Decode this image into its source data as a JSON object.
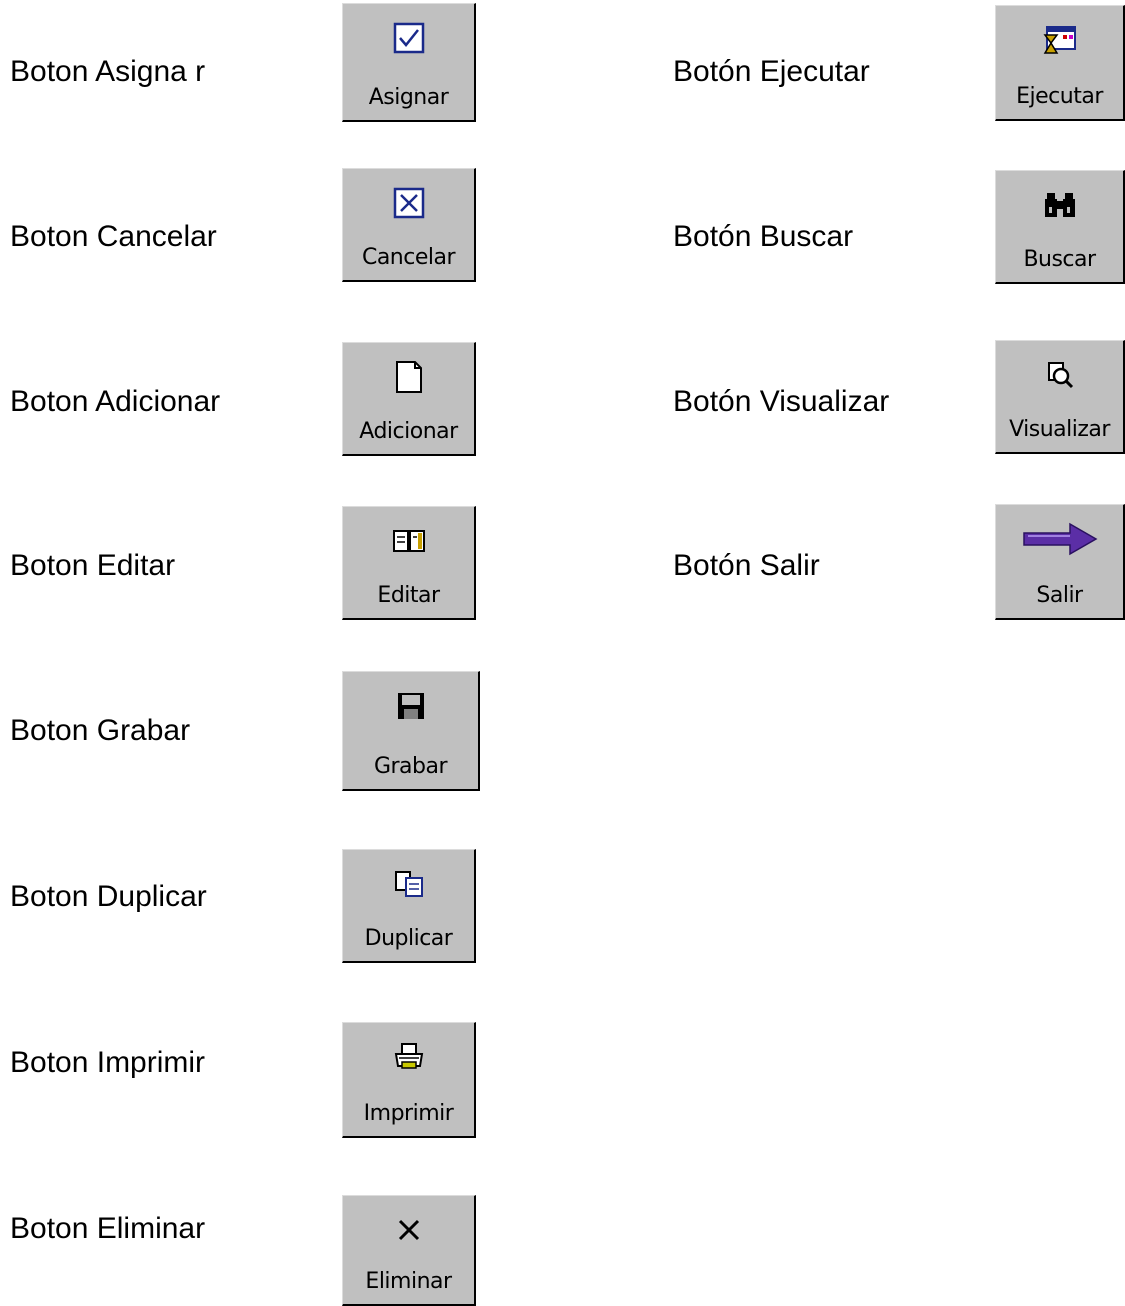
{
  "left_column": [
    {
      "label": "Boton Asigna r",
      "button": "Asignar",
      "icon": "checkbox-checked-icon"
    },
    {
      "label": "Boton Cancelar",
      "button": "Cancelar",
      "icon": "checkbox-x-icon"
    },
    {
      "label": "Boton Adicionar",
      "button": "Adicionar",
      "icon": "new-document-icon"
    },
    {
      "label": "Boton Editar",
      "button": "Editar",
      "icon": "open-book-icon"
    },
    {
      "label": "Boton Grabar",
      "button": "Grabar",
      "icon": "floppy-disk-icon"
    },
    {
      "label": "Boton Duplicar",
      "button": "Duplicar",
      "icon": "copy-pages-icon"
    },
    {
      "label": "Boton Imprimir",
      "button": "Imprimir",
      "icon": "printer-icon"
    },
    {
      "label": "Boton Eliminar",
      "button": "Eliminar",
      "icon": "delete-x-icon"
    }
  ],
  "right_column": [
    {
      "label": "Botón Ejecutar",
      "button": "Ejecutar",
      "icon": "run-hourglass-icon"
    },
    {
      "label": "Botón Buscar",
      "button": "Buscar",
      "icon": "binoculars-icon"
    },
    {
      "label": "Botón Visualizar",
      "button": "Visualizar",
      "icon": "magnify-page-icon"
    },
    {
      "label": "Botón Salir",
      "button": "Salir",
      "icon": "exit-arrow-icon"
    }
  ],
  "colors": {
    "button_face": "#c0c0c0",
    "arrow": "#5b2ea6",
    "icon_blue": "#1a2a8a"
  }
}
